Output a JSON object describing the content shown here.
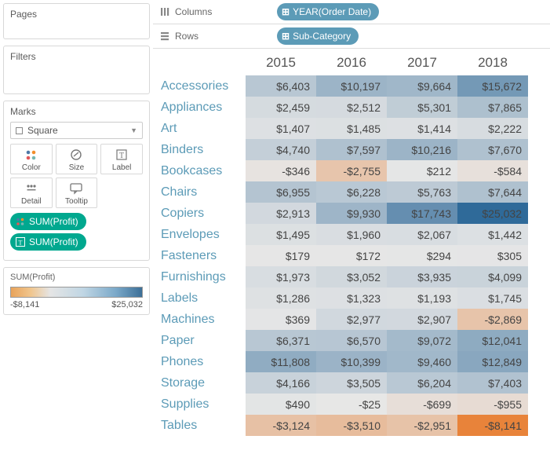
{
  "panels": {
    "pages": "Pages",
    "filters": "Filters",
    "marks": "Marks"
  },
  "markType": "Square",
  "markButtons": {
    "color": "Color",
    "size": "Size",
    "label": "Label",
    "detail": "Detail",
    "tooltip": "Tooltip"
  },
  "marksCards": {
    "color_pill": "SUM(Profit)",
    "label_pill": "SUM(Profit)"
  },
  "legend": {
    "title": "SUM(Profit)",
    "min": "-$8,141",
    "max": "$25,032"
  },
  "shelves": {
    "columns_label": "Columns",
    "rows_label": "Rows",
    "columns_pill": "YEAR(Order Date)",
    "rows_pill": "Sub-Category"
  },
  "chart_data": {
    "type": "heatmap",
    "title": "",
    "xlabel": "YEAR(Order Date)",
    "ylabel": "Sub-Category",
    "color_measure": "SUM(Profit)",
    "color_range": [
      -8141,
      25032
    ],
    "color_scale": "diverging-orange-blue",
    "x": [
      "2015",
      "2016",
      "2017",
      "2018"
    ],
    "categories": [
      "Accessories",
      "Appliances",
      "Art",
      "Binders",
      "Bookcases",
      "Chairs",
      "Copiers",
      "Envelopes",
      "Fasteners",
      "Furnishings",
      "Labels",
      "Machines",
      "Paper",
      "Phones",
      "Storage",
      "Supplies",
      "Tables"
    ],
    "values": [
      [
        6403,
        10197,
        9664,
        15672
      ],
      [
        2459,
        2512,
        5301,
        7865
      ],
      [
        1407,
        1485,
        1414,
        2222
      ],
      [
        4740,
        7597,
        10216,
        7670
      ],
      [
        -346,
        -2755,
        212,
        -584
      ],
      [
        6955,
        6228,
        5763,
        7644
      ],
      [
        2913,
        9930,
        17743,
        25032
      ],
      [
        1495,
        1960,
        2067,
        1442
      ],
      [
        179,
        172,
        294,
        305
      ],
      [
        1973,
        3052,
        3935,
        4099
      ],
      [
        1286,
        1323,
        1193,
        1745
      ],
      [
        369,
        2977,
        2907,
        -2869
      ],
      [
        6371,
        6570,
        9072,
        12041
      ],
      [
        11808,
        10399,
        9460,
        12849
      ],
      [
        4166,
        3505,
        6204,
        7403
      ],
      [
        490,
        -25,
        -699,
        -955
      ],
      [
        -3124,
        -3510,
        -2951,
        -8141
      ]
    ],
    "display": [
      [
        "$6,403",
        "$10,197",
        "$9,664",
        "$15,672"
      ],
      [
        "$2,459",
        "$2,512",
        "$5,301",
        "$7,865"
      ],
      [
        "$1,407",
        "$1,485",
        "$1,414",
        "$2,222"
      ],
      [
        "$4,740",
        "$7,597",
        "$10,216",
        "$7,670"
      ],
      [
        "-$346",
        "-$2,755",
        "$212",
        "-$584"
      ],
      [
        "$6,955",
        "$6,228",
        "$5,763",
        "$7,644"
      ],
      [
        "$2,913",
        "$9,930",
        "$17,743",
        "$25,032"
      ],
      [
        "$1,495",
        "$1,960",
        "$2,067",
        "$1,442"
      ],
      [
        "$179",
        "$172",
        "$294",
        "$305"
      ],
      [
        "$1,973",
        "$3,052",
        "$3,935",
        "$4,099"
      ],
      [
        "$1,286",
        "$1,323",
        "$1,193",
        "$1,745"
      ],
      [
        "$369",
        "$2,977",
        "$2,907",
        "-$2,869"
      ],
      [
        "$6,371",
        "$6,570",
        "$9,072",
        "$12,041"
      ],
      [
        "$11,808",
        "$10,399",
        "$9,460",
        "$12,849"
      ],
      [
        "$4,166",
        "$3,505",
        "$6,204",
        "$7,403"
      ],
      [
        "$490",
        "-$25",
        "-$699",
        "-$955"
      ],
      [
        "-$3,124",
        "-$3,510",
        "-$2,951",
        "-$8,141"
      ]
    ]
  }
}
